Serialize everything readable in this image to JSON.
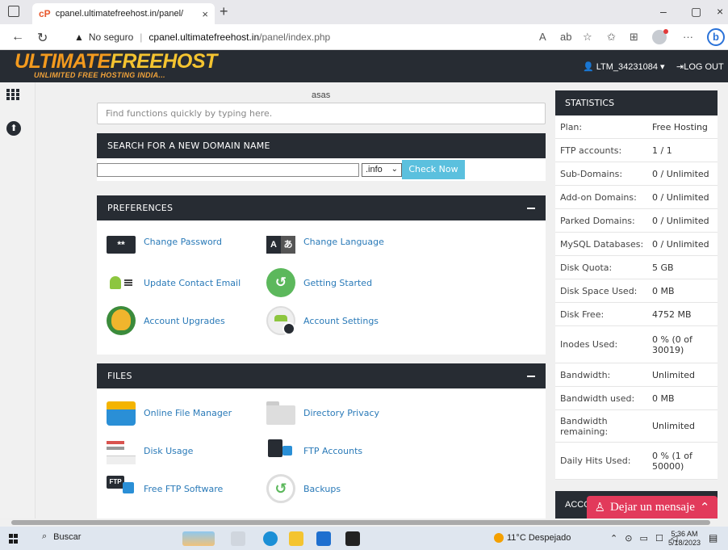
{
  "browser": {
    "tab_title": "cpanel.ultimatefreehost.in/panel/",
    "url_warning": "No seguro",
    "url_host": "cpanel.ultimatefreehost.in",
    "url_path": "/panel/index.php"
  },
  "header": {
    "logo_line1_a": "ULTIMATE",
    "logo_line1_b": "FREEHOST",
    "logo_line2": "UNLIMITED FREE HOSTING INDIA...",
    "username": "LTM_34231084",
    "logout": "LOG OUT"
  },
  "quick": {
    "label": "asas",
    "placeholder": "Find functions quickly by typing here."
  },
  "domain_search": {
    "title": "SEARCH FOR A NEW DOMAIN NAME",
    "tld": ".info",
    "button": "Check Now"
  },
  "preferences": {
    "title": "PREFERENCES",
    "items": [
      {
        "label": "Change Password",
        "icon": "password-icon"
      },
      {
        "label": "Change Language",
        "icon": "language-icon"
      },
      {
        "label": "Update Contact Email",
        "icon": "contact-email-icon"
      },
      {
        "label": "Getting Started",
        "icon": "getting-started-icon"
      },
      {
        "label": "Account Upgrades",
        "icon": "account-upgrades-icon"
      },
      {
        "label": "Account Settings",
        "icon": "account-settings-icon"
      }
    ]
  },
  "files": {
    "title": "FILES",
    "items": [
      {
        "label": "Online File Manager",
        "icon": "file-manager-icon"
      },
      {
        "label": "Directory Privacy",
        "icon": "directory-privacy-icon"
      },
      {
        "label": "Disk Usage",
        "icon": "disk-usage-icon"
      },
      {
        "label": "FTP Accounts",
        "icon": "ftp-accounts-icon"
      },
      {
        "label": "Free FTP Software",
        "icon": "free-ftp-icon"
      },
      {
        "label": "Backups",
        "icon": "backups-icon"
      }
    ]
  },
  "statistics": {
    "title": "STATISTICS",
    "rows": [
      {
        "k": "Plan:",
        "v": "Free Hosting"
      },
      {
        "k": "FTP accounts:",
        "v": "1 / 1"
      },
      {
        "k": "Sub-Domains:",
        "v": "0 / Unlimited"
      },
      {
        "k": "Add-on Domains:",
        "v": "0 / Unlimited"
      },
      {
        "k": "Parked Domains:",
        "v": "0 / Unlimited"
      },
      {
        "k": "MySQL Databases:",
        "v": "0 / Unlimited"
      },
      {
        "k": "Disk Quota:",
        "v": "5 GB"
      },
      {
        "k": "Disk Space Used:",
        "v": "0 MB"
      },
      {
        "k": "Disk Free:",
        "v": "4752 MB"
      },
      {
        "k": "Inodes Used:",
        "v": "0 % (0 of 30019)"
      },
      {
        "k": "Bandwidth:",
        "v": "Unlimited"
      },
      {
        "k": "Bandwidth used:",
        "v": "0 MB"
      },
      {
        "k": "Bandwidth remaining:",
        "v": "Unlimited"
      },
      {
        "k": "Daily Hits Used:",
        "v": "0 % (1 of 50000)"
      }
    ],
    "account_header": "ACCO"
  },
  "chat": {
    "label": "Dejar un mensaje"
  },
  "taskbar": {
    "search": "Buscar",
    "weather": "11°C Despejado",
    "time": "5:36 AM",
    "date": "5/18/2023"
  }
}
